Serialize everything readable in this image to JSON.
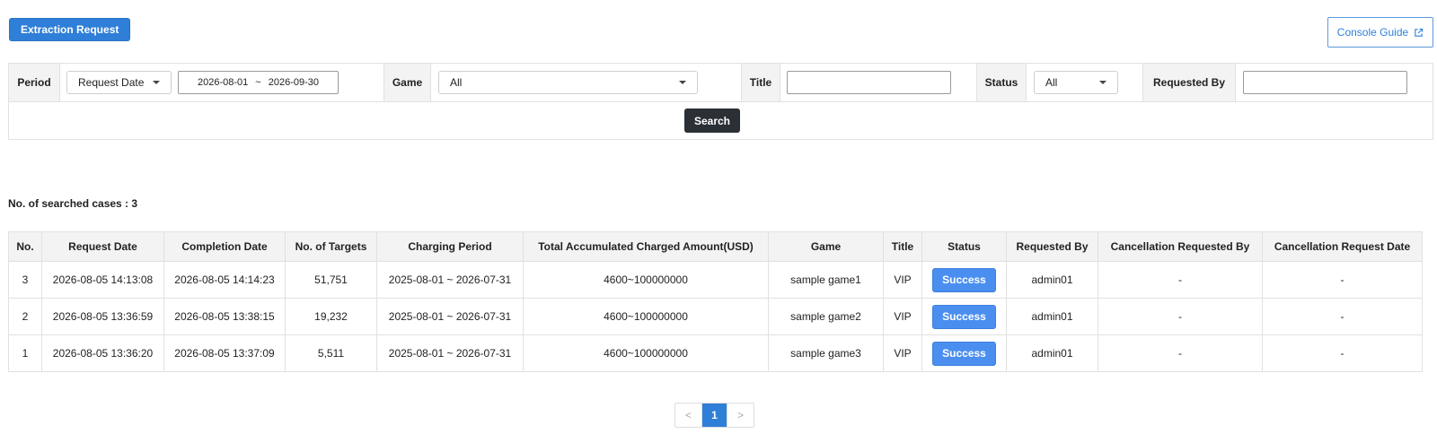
{
  "toolbar": {
    "extraction_request_label": "Extraction Request",
    "console_guide_label": "Console Guide"
  },
  "filters": {
    "period_label": "Period",
    "period_type_value": "Request Date",
    "date_from": "2026-08-01",
    "date_sep": "~",
    "date_to": "2026-09-30",
    "game_label": "Game",
    "game_value": "All",
    "title_label": "Title",
    "title_value": "",
    "status_label": "Status",
    "status_value": "All",
    "requested_by_label": "Requested By",
    "requested_by_value": "",
    "search_label": "Search"
  },
  "results": {
    "count_text": "No. of searched cases : 3",
    "columns": [
      "No.",
      "Request Date",
      "Completion Date",
      "No. of Targets",
      "Charging Period",
      "Total Accumulated Charged Amount(USD)",
      "Game",
      "Title",
      "Status",
      "Requested By",
      "Cancellation Requested By",
      "Cancellation Request Date"
    ],
    "rows": [
      [
        "3",
        "2026-08-05 14:13:08",
        "2026-08-05 14:14:23",
        "51,751",
        "2025-08-01 ~ 2026-07-31",
        "4600~100000000",
        "sample game1",
        "VIP",
        "Success",
        "admin01",
        "-",
        "-"
      ],
      [
        "2",
        "2026-08-05 13:36:59",
        "2026-08-05 13:38:15",
        "19,232",
        "2025-08-01 ~ 2026-07-31",
        "4600~100000000",
        "sample game2",
        "VIP",
        "Success",
        "admin01",
        "-",
        "-"
      ],
      [
        "1",
        "2026-08-05 13:36:20",
        "2026-08-05 13:37:09",
        "5,511",
        "2025-08-01 ~ 2026-07-31",
        "4600~100000000",
        "sample game3",
        "VIP",
        "Success",
        "admin01",
        "-",
        "-"
      ]
    ]
  },
  "pagination": {
    "prev": "<",
    "current": "1",
    "next": ">"
  },
  "colors": {
    "primary": "#2f7fd8",
    "status_success": "#4a8ff0",
    "search_button": "#2b2f36"
  },
  "icons": {
    "external_link": "external-link-icon",
    "dropdown": "chevron-down-icon"
  }
}
